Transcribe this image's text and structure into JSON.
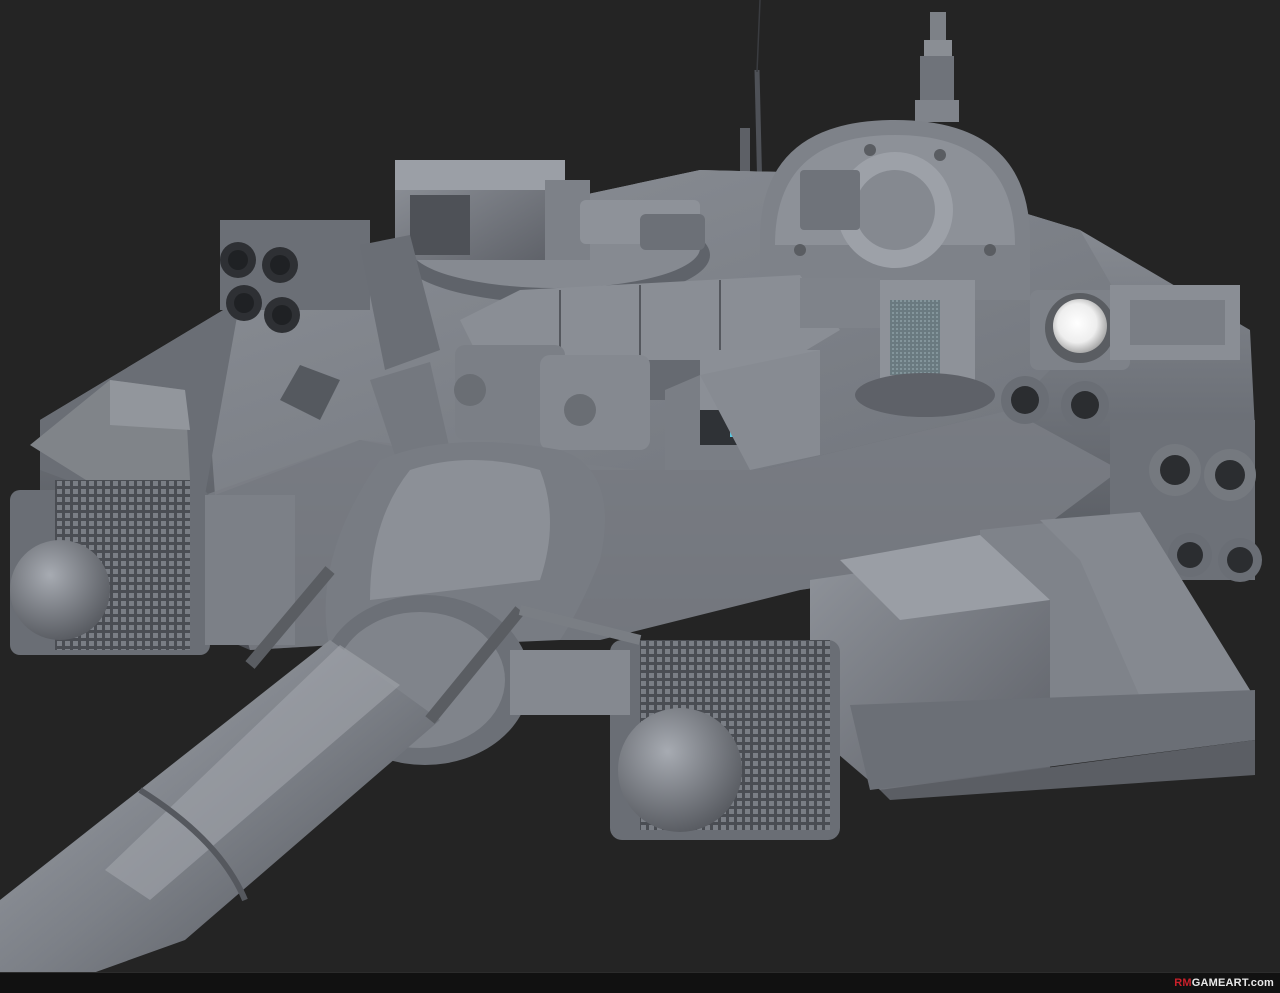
{
  "watermark": {
    "brand_prefix": "RM",
    "brand_rest": "GAMEART.com"
  },
  "colors": {
    "background": "#242424",
    "model_base": "#6f737a",
    "model_light": "#9a9ea5",
    "model_dark": "#3a3d42",
    "periscope_glow": "#59c6e0",
    "searchlight": "#f4f4f4",
    "watermark_accent": "#c8202a"
  },
  "subject": {
    "icon": "tank-turret-render"
  }
}
